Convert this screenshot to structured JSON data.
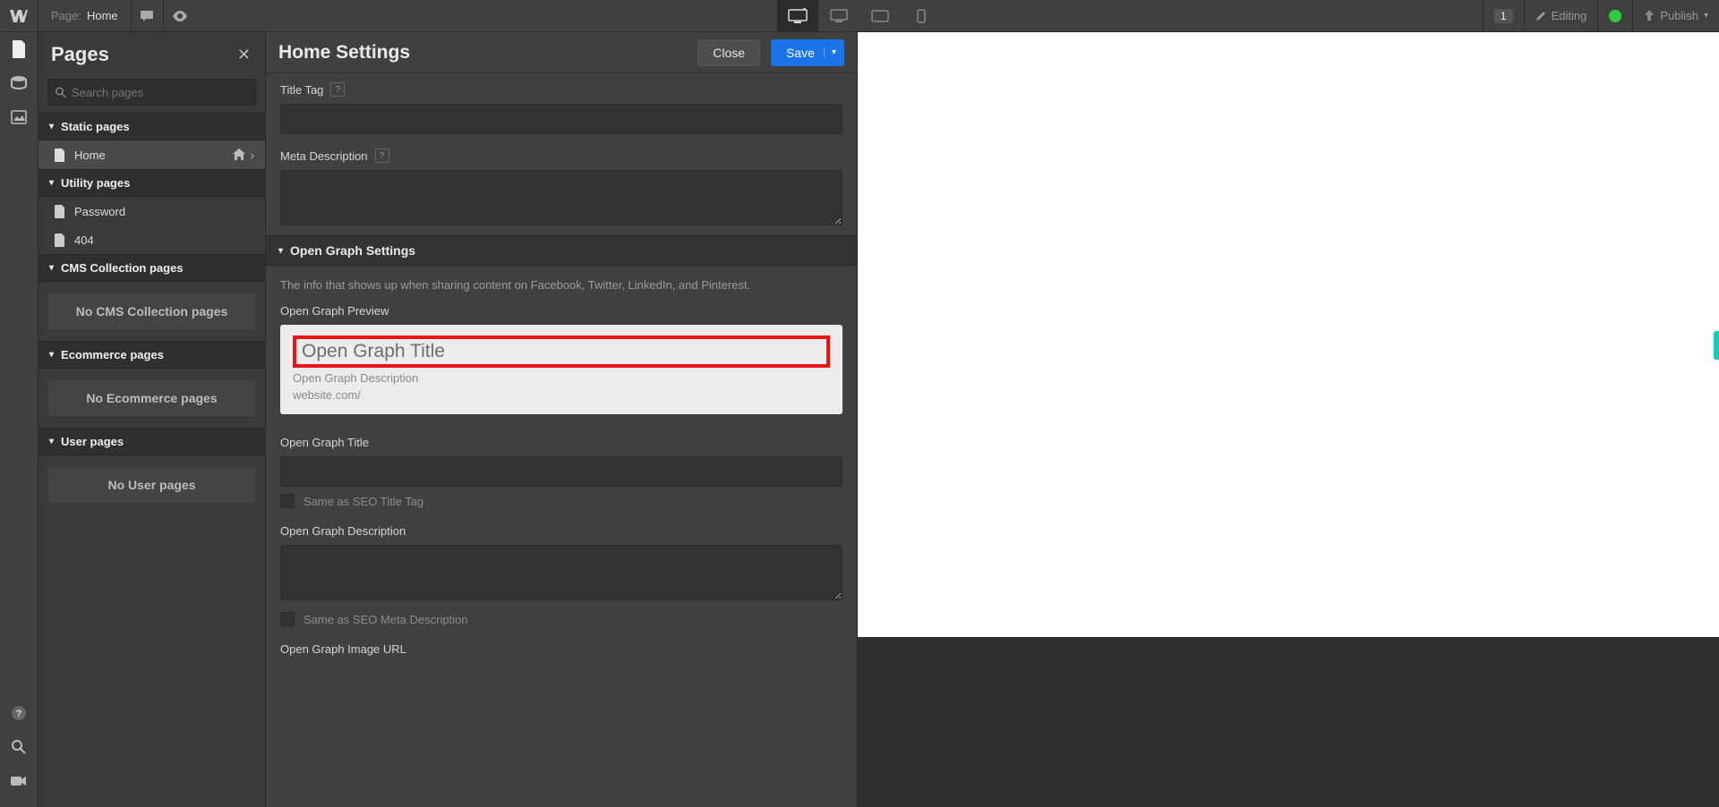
{
  "topbar": {
    "page_prefix": "Page:",
    "page_name": "Home",
    "users_badge": "1",
    "editing_label": "Editing",
    "publish_label": "Publish"
  },
  "pages_panel": {
    "title": "Pages",
    "search_placeholder": "Search pages",
    "groups": {
      "static": "Static pages",
      "utility": "Utility pages",
      "cms": "CMS Collection pages",
      "ecom": "Ecommerce pages",
      "user": "User pages"
    },
    "items": {
      "home": "Home",
      "password": "Password",
      "notfound": "404"
    },
    "empty": {
      "cms": "No CMS Collection pages",
      "ecom": "No Ecommerce pages",
      "user": "No User pages"
    }
  },
  "settings": {
    "title": "Home Settings",
    "close": "Close",
    "save": "Save",
    "labels": {
      "title_tag": "Title Tag",
      "meta_desc": "Meta Description",
      "og_section": "Open Graph Settings",
      "og_hint": "The info that shows up when sharing content on Facebook, Twitter, LinkedIn, and Pinterest.",
      "og_preview": "Open Graph Preview",
      "og_title": "Open Graph Title",
      "og_desc": "Open Graph Description",
      "og_image": "Open Graph Image URL",
      "same_title": "Same as SEO Title Tag",
      "same_desc": "Same as SEO Meta Description"
    },
    "preview": {
      "title": "Open Graph Title",
      "desc": "Open Graph Description",
      "url": "website.com/"
    }
  }
}
